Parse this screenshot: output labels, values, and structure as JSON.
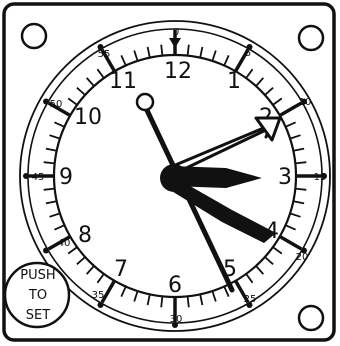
{
  "clock": {
    "hour_numerals": [
      "12",
      "1",
      "2",
      "3",
      "4",
      "5",
      "6",
      "7",
      "8",
      "9",
      "10",
      "11"
    ],
    "minute_labels": [
      "0",
      "5",
      "10",
      "15",
      "20",
      "25",
      "30",
      "35",
      "40",
      "45",
      "50",
      "55"
    ],
    "hands": {
      "hours": 2.72,
      "minutes": 26.5,
      "elapsed_minutes": 13.0,
      "elapsed_hours": 5.2
    },
    "push_to_set": {
      "line1": "PUSH",
      "line2": "TO",
      "line3": "SET"
    },
    "colors": {
      "ink": "#111111",
      "face": "#ffffff"
    }
  }
}
